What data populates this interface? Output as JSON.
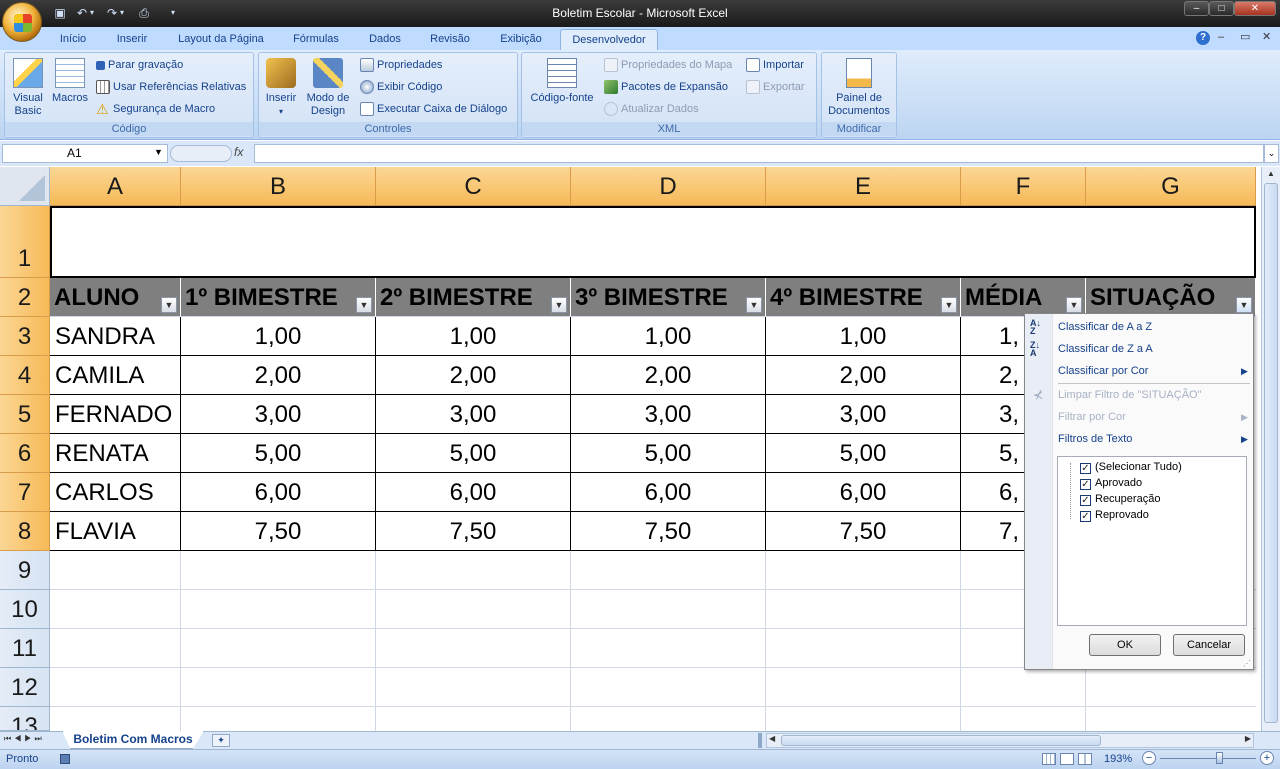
{
  "window": {
    "title": "Boletim Escolar - Microsoft Excel",
    "min": "–",
    "max": "□",
    "close": "✕"
  },
  "ribbon_tabs": [
    "Início",
    "Inserir",
    "Layout da Página",
    "Fórmulas",
    "Dados",
    "Revisão",
    "Exibição",
    "Desenvolvedor"
  ],
  "active_tab": "Desenvolvedor",
  "ribbon": {
    "codigo": {
      "caption": "Código",
      "visual_basic": "Visual Basic",
      "vb_line1": "Visual",
      "vb_line2": "Basic",
      "macros": "Macros",
      "parar": "Parar gravação",
      "referencias": "Usar Referências Relativas",
      "seguranca": "Segurança de Macro"
    },
    "controles": {
      "caption": "Controles",
      "inserir": "Inserir",
      "modo_line1": "Modo de",
      "modo_line2": "Design",
      "propriedades": "Propriedades",
      "exibir_codigo": "Exibir Código",
      "executar": "Executar Caixa de Diálogo"
    },
    "xml": {
      "caption": "XML",
      "codigo_fonte": "Código-fonte",
      "prop_mapa": "Propriedades do Mapa",
      "pacotes": "Pacotes de Expansão",
      "atualizar": "Atualizar Dados",
      "importar": "Importar",
      "exportar": "Exportar"
    },
    "modificar": {
      "caption": "Modificar",
      "painel_line1": "Painel de",
      "painel_line2": "Documentos"
    }
  },
  "formula_bar": {
    "name_box": "A1",
    "fx": "fx",
    "formula": ""
  },
  "columns": [
    "A",
    "B",
    "C",
    "D",
    "E",
    "F",
    "G"
  ],
  "rows": [
    "1",
    "2",
    "3",
    "4",
    "5",
    "6",
    "7",
    "8",
    "9",
    "10",
    "11",
    "12",
    "13"
  ],
  "table": {
    "headers": [
      "ALUNO",
      "1º BIMESTRE",
      "2º BIMESTRE",
      "3º BIMESTRE",
      "4º BIMESTRE",
      "MÉDIA",
      "SITUAÇÃO"
    ],
    "data": [
      [
        "SANDRA",
        "1,00",
        "1,00",
        "1,00",
        "1,00",
        "1,"
      ],
      [
        "CAMILA",
        "2,00",
        "2,00",
        "2,00",
        "2,00",
        "2,"
      ],
      [
        "FERNADO",
        "3,00",
        "3,00",
        "3,00",
        "3,00",
        "3,"
      ],
      [
        "RENATA",
        "5,00",
        "5,00",
        "5,00",
        "5,00",
        "5,"
      ],
      [
        "CARLOS",
        "6,00",
        "6,00",
        "6,00",
        "6,00",
        "6,"
      ],
      [
        "FLAVIA",
        "7,50",
        "7,50",
        "7,50",
        "7,50",
        "7,"
      ]
    ]
  },
  "filter_menu": {
    "sort_az": "Classificar de A a Z",
    "sort_za": "Classificar de Z a A",
    "sort_color": "Classificar por Cor",
    "clear": "Limpar Filtro de \"SITUAÇÃO\"",
    "filter_color": "Filtrar por Cor",
    "text_filters": "Filtros de Texto",
    "items": [
      "(Selecionar Tudo)",
      "Aprovado",
      "Recuperação",
      "Reprovado"
    ],
    "ok": "OK",
    "cancel": "Cancelar"
  },
  "sheet_tabs": [
    "Boletim Com Macros"
  ],
  "status": {
    "ready": "Pronto",
    "zoom": "193%"
  }
}
